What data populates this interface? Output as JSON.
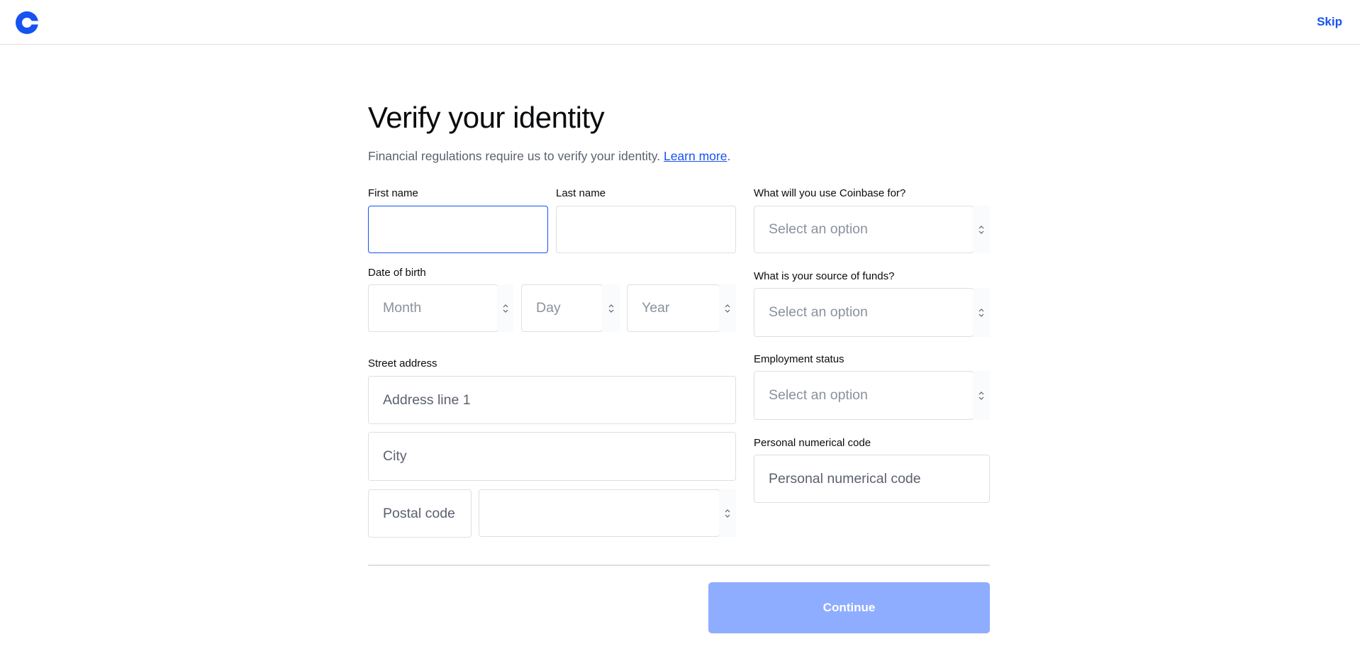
{
  "header": {
    "skip_label": "Skip",
    "brand_color": "#1652f0"
  },
  "page": {
    "title": "Verify your identity",
    "subtitle": "Financial regulations require us to verify your identity. ",
    "learn_more": "Learn more",
    "period": "."
  },
  "form": {
    "first_name": {
      "label": "First name",
      "value": ""
    },
    "last_name": {
      "label": "Last name",
      "value": ""
    },
    "dob": {
      "label": "Date of birth",
      "month_placeholder": "Month",
      "day_placeholder": "Day",
      "year_placeholder": "Year"
    },
    "street": {
      "label": "Street address",
      "address_placeholder": "Address line 1",
      "city_placeholder": "City",
      "postal_placeholder": "Postal code",
      "country_value": ""
    },
    "usage": {
      "label": "What will you use Coinbase for?",
      "placeholder": "Select an option"
    },
    "funds": {
      "label": "What is your source of funds?",
      "placeholder": "Select an option"
    },
    "employment": {
      "label": "Employment status",
      "placeholder": "Select an option"
    },
    "pnc": {
      "label": "Personal numerical code",
      "placeholder": "Personal numerical code"
    }
  },
  "footer": {
    "continue_label": "Continue",
    "continue_color": "#8fadff"
  }
}
